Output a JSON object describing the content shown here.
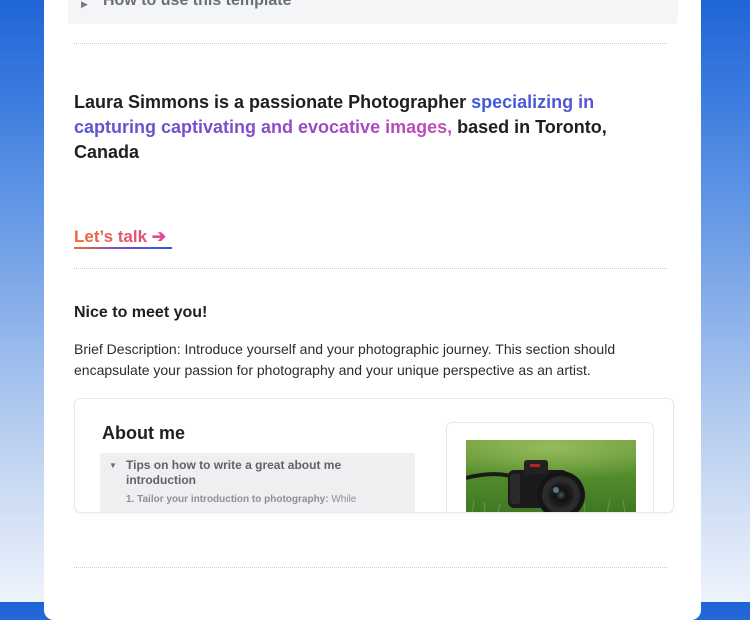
{
  "toggle": {
    "title": "How to use this template"
  },
  "hero": {
    "part1": "Laura Simmons is a passionate Photographer ",
    "highlight": "specializing in capturing captivating and evocative images,",
    "part2": " based in Toronto, Canada"
  },
  "cta": {
    "label": "Let’s talk ➔"
  },
  "intro": {
    "heading": "Nice to meet you!",
    "description": "Brief Description: Introduce yourself and your photographic journey. This section should encapsulate your passion for photography and your unique perspective as an artist."
  },
  "about": {
    "title": "About me",
    "tips_title": "Tips on how to write a great about me introduction",
    "tips_item_bold": "1. Tailor your introduction to photography:",
    "tips_item_rest": " While"
  },
  "colors": {
    "page_background_top": "#1f64d6",
    "text_primary": "#1e1f22",
    "highlight_gradient": [
      "#3b5bdb",
      "#7c4dcc",
      "#c64bb8"
    ],
    "cta_gradient": [
      "#f06a2c",
      "#e0459a"
    ]
  }
}
